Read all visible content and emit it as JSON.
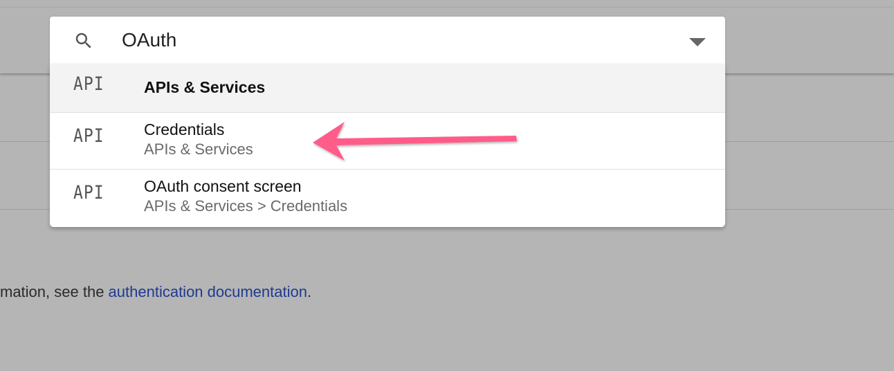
{
  "search": {
    "query": "OAuth"
  },
  "results": [
    {
      "icon": "API",
      "title": "APIs & Services",
      "subtitle": ""
    },
    {
      "icon": "API",
      "title": "Credentials",
      "subtitle": "APIs & Services"
    },
    {
      "icon": "API",
      "title": "OAuth consent screen",
      "subtitle": "APIs & Services > Credentials"
    }
  ],
  "background": {
    "text_prefix": "mation, see the ",
    "link_text": "authentication documentation",
    "text_suffix": "."
  },
  "icons": {
    "search": "search-icon",
    "dropdown": "chevron-down-icon",
    "api": "api-icon",
    "annotation": "pointer-arrow"
  },
  "colors": {
    "overlay_background": "#b5b5b5",
    "link": "#1f3a8f",
    "annotation_arrow": "#ff5c8a",
    "active_row": "#f3f3f3"
  }
}
